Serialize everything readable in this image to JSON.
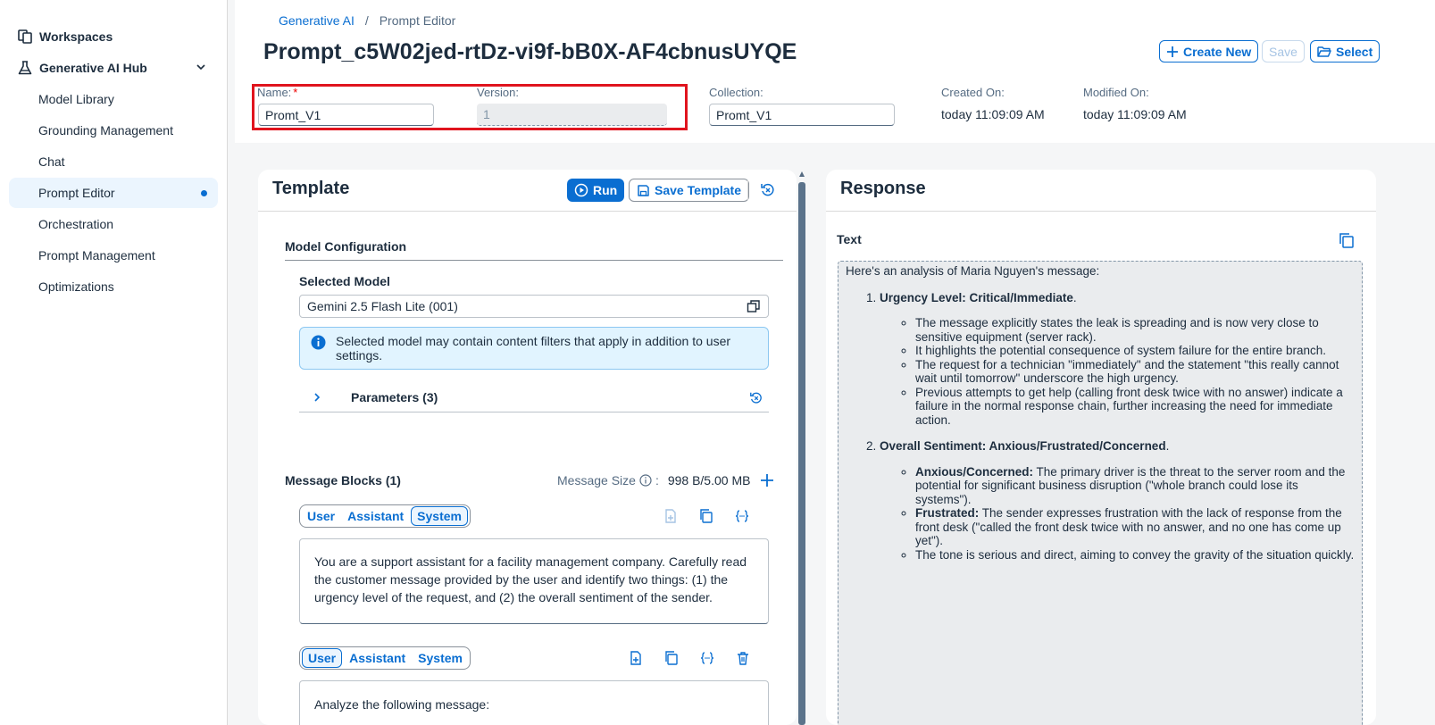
{
  "sidebar": {
    "workspaces": "Workspaces",
    "hub": "Generative AI Hub",
    "items": [
      "Model Library",
      "Grounding Management",
      "Chat",
      "Prompt Editor",
      "Orchestration",
      "Prompt Management",
      "Optimizations"
    ]
  },
  "header": {
    "breadcrumb_root": "Generative AI",
    "breadcrumb_sep": "/",
    "breadcrumb_current": "Prompt Editor",
    "title": "Prompt_c5W02jed-rtDz-vi9f-bB0X-AF4cbnusUYQE",
    "create_new": "Create New",
    "save": "Save",
    "select": "Select",
    "name_label": "Name:",
    "name_required": "*",
    "name_value": "Promt_V1",
    "version_label": "Version:",
    "version_value": "1",
    "collection_label": "Collection:",
    "collection_value": "Promt_V1",
    "created_label": "Created On:",
    "created_value": "today 11:09:09 AM",
    "modified_label": "Modified On:",
    "modified_value": "today 11:09:09 AM"
  },
  "template": {
    "title": "Template",
    "run": "Run",
    "save_template": "Save Template",
    "model_config": "Model Configuration",
    "selected_model_label": "Selected Model",
    "selected_model_value": "Gemini 2.5 Flash Lite (001)",
    "info_text": "Selected model may contain content filters that apply in addition to user settings.",
    "parameters": "Parameters (3)",
    "message_blocks": "Message Blocks (1)",
    "message_size_label": "Message Size",
    "message_size_sep": ":",
    "message_size_value": "998 B/5.00 MB",
    "roles": [
      "User",
      "Assistant",
      "System"
    ],
    "system_message": "You are a support assistant for a facility management company. Carefully read the customer message provided by the user and identify two things: (1) the urgency level of the request, and (2) the overall sentiment of the sender.",
    "user_message": "Analyze the following message:"
  },
  "response": {
    "title": "Response",
    "text_label": "Text",
    "intro": "Here's an analysis of Maria Nguyen's message:",
    "point1_title": "Urgency Level: Critical/Immediate",
    "point1_bullets": [
      "The message explicitly states the leak is spreading and is now very close to sensitive equipment (server rack).",
      "It highlights the potential consequence of system failure for the entire branch.",
      "The request for a technician \"immediately\" and the statement \"this really cannot wait until tomorrow\" underscore the high urgency.",
      "Previous attempts to get help (calling front desk twice with no answer) indicate a failure in the normal response chain, further increasing the need for immediate action."
    ],
    "point2_title": "Overall Sentiment: Anxious/Frustrated/Concerned",
    "point2_b1_bold": "Anxious/Concerned:",
    "point2_b1_text": " The primary driver is the threat to the server room and the potential for significant business disruption (\"whole branch could lose its systems\").",
    "point2_b2_bold": "Frustrated:",
    "point2_b2_text": " The sender expresses frustration with the lack of response from the front desk (\"called the front desk twice with no answer, and no one has come up yet\").",
    "point2_b3": "The tone is serious and direct, aiming to convey the gravity of the situation quickly."
  },
  "colors": {
    "accent": "#0a6ed1",
    "highlight": "#e0141e"
  }
}
